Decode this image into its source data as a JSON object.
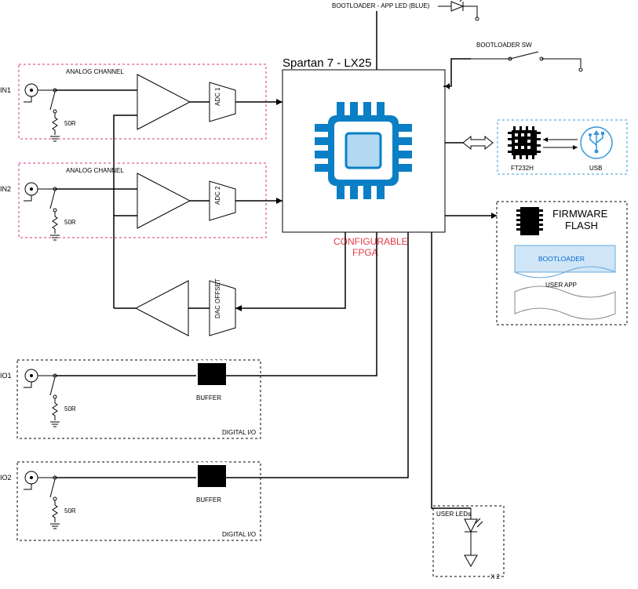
{
  "top": {
    "led_label": "BOOTLOADER - APP LED (BLUE)",
    "sw_label": "BOOTLOADER SW"
  },
  "fpga": {
    "title": "Spartan 7 - LX25",
    "subtitle1": "CONFIGURABLE",
    "subtitle2": "FPGA"
  },
  "ch1": {
    "label": "ANALOG CHANNEL",
    "in": "IN1",
    "res": "50R",
    "adc": "ADC 1"
  },
  "ch2": {
    "label": "ANALOG CHANNEL",
    "in": "IN2",
    "res": "50R",
    "adc": "ADC 2"
  },
  "dac": {
    "label": "DAC OFFSET"
  },
  "io1": {
    "label": "DIGITAL I/O",
    "in": "IO1",
    "res": "50R",
    "buf": "BUFFER"
  },
  "io2": {
    "label": "DIGITAL I/O",
    "in": "IO2",
    "res": "50R",
    "buf": "BUFFER"
  },
  "right": {
    "ft": "FT232H",
    "usb": "USB",
    "flash_title": "FIRMWARE FLASH",
    "flash_boot": "BOOTLOADER",
    "flash_user": "USER APP"
  },
  "leds": {
    "label": "USER LEDs",
    "mult": "X 2"
  }
}
